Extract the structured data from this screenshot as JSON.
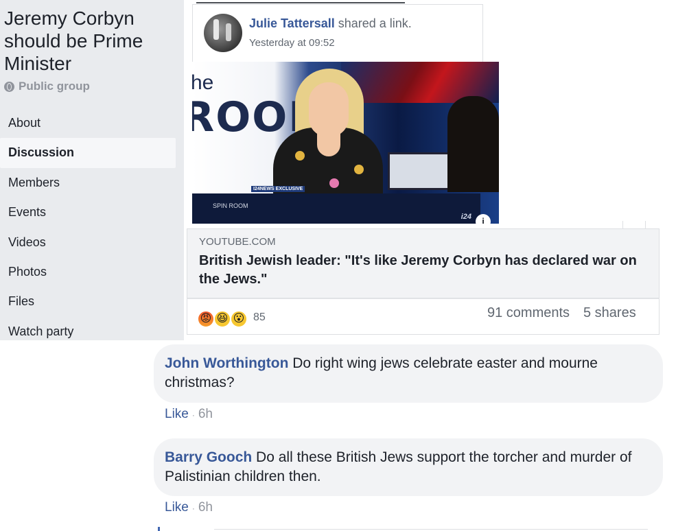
{
  "group": {
    "title": "Jeremy Corbyn should be Prime Minister",
    "privacy": "Public group"
  },
  "nav": {
    "items": [
      {
        "label": "About",
        "active": false
      },
      {
        "label": "Discussion",
        "active": true
      },
      {
        "label": "Members",
        "active": false
      },
      {
        "label": "Events",
        "active": false
      },
      {
        "label": "Videos",
        "active": false
      },
      {
        "label": "Photos",
        "active": false
      },
      {
        "label": "Files",
        "active": false
      },
      {
        "label": "Watch party",
        "active": false
      }
    ]
  },
  "post": {
    "author": "Julie Tattersall",
    "action": "shared a link.",
    "time": "Yesterday at 09:52",
    "video": {
      "overlay_he": "he",
      "overlay_room": "ROOM",
      "badge": "I24NEWS EXCLUSIVE",
      "brand_room": "SPIN ROOM",
      "brand_channel": "i24",
      "info_icon_label": "i"
    },
    "link": {
      "domain": "YOUTUBE.COM",
      "title": "British Jewish leader: \"It's like Jeremy Corbyn has declared war on the Jews.\""
    },
    "reactions": {
      "icons": [
        "angry-icon",
        "haha-icon",
        "wow-icon"
      ],
      "count": "85",
      "comments": "91 comments",
      "shares": "5 shares"
    }
  },
  "comments": [
    {
      "author": "John Worthington",
      "text": "Do right wing jews celebrate easter and mourne christmas?",
      "like_label": "Like",
      "time": "6h"
    },
    {
      "author": "Barry Gooch",
      "text": "Do all these British Jews support the torcher and murder of Palistinian children then.",
      "like_label": "Like",
      "time": "6h"
    }
  ],
  "colors": {
    "link_blue": "#385898",
    "meta_grey": "#90949c",
    "sidebar_bg": "#e9ebee",
    "bubble_bg": "#f2f3f5"
  }
}
